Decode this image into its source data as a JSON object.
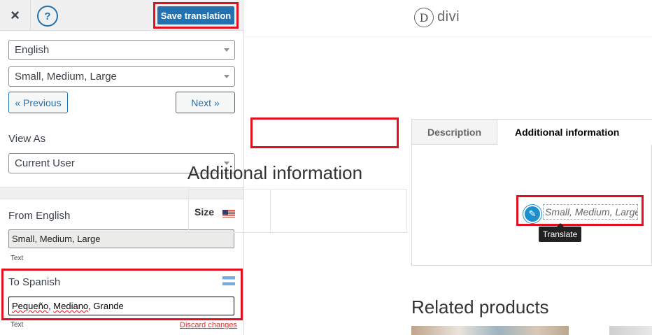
{
  "panel": {
    "close_icon": "×",
    "help_icon": "?",
    "save_label": "Save translation",
    "language_select": "English",
    "string_select": "Small, Medium, Large",
    "previous_label": "« Previous",
    "next_label": "Next »",
    "view_as_label": "View As",
    "view_as_select": "Current User",
    "from_label": "From English",
    "from_value": "Small, Medium, Large",
    "from_type": "Text",
    "to_label": "To Spanish",
    "to_value_parts": [
      "Pequeño",
      ", ",
      "Mediano",
      ", Grande"
    ],
    "to_type": "Text",
    "discard_label": "Discard changes"
  },
  "preview": {
    "logo_letter": "D",
    "logo_text": "divi",
    "tab_description": "Description",
    "tab_additional": "Additional information",
    "section_heading": "Additional information",
    "attr_label": "Size",
    "attr_value": "Small, Medium, Large",
    "tooltip": "Translate",
    "related_heading": "Related products"
  },
  "colors": {
    "accent": "#2271b1",
    "highlight_border": "#e2101f",
    "pencil": "#1d8fce"
  }
}
